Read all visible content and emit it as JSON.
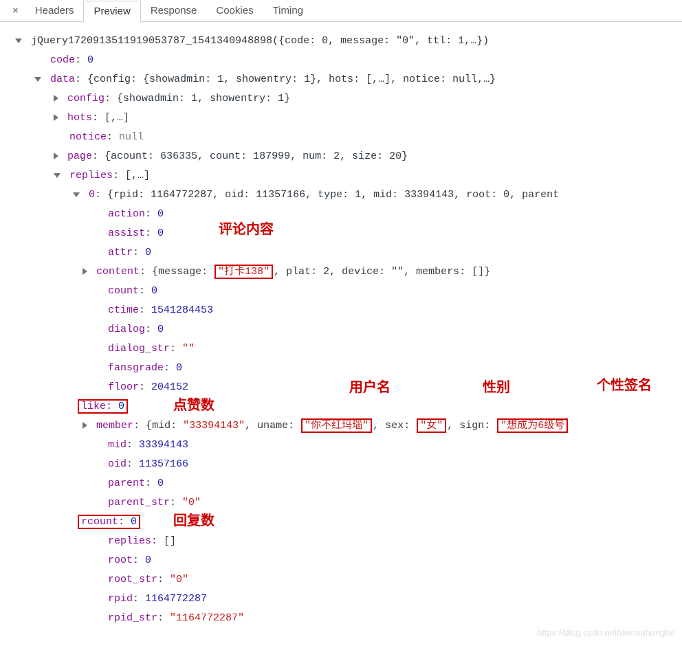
{
  "tabs": {
    "close": "×",
    "headers": "Headers",
    "preview": "Preview",
    "response": "Response",
    "cookies": "Cookies",
    "timing": "Timing"
  },
  "callback": "jQuery17209135119190537​87_1541340948898",
  "root_summary": "{code: 0, message: \"0\", ttl: 1,…}",
  "code": {
    "key": "code",
    "val": "0"
  },
  "data": {
    "key": "data",
    "summary": "{config: {showadmin: 1, showentry: 1}, hots: [,…], notice: null,…}",
    "config": {
      "key": "config",
      "summary": "{showadmin: 1, showentry: 1}"
    },
    "hots": {
      "key": "hots",
      "summary": "[,…]"
    },
    "notice": {
      "key": "notice",
      "val": "null"
    },
    "page": {
      "key": "page",
      "summary": "{acount: 636335, count: 187999, num: 2, size: 20}"
    },
    "replies": {
      "key": "replies",
      "summary": "[,…]",
      "item0": {
        "key": "0",
        "summary": "{rpid: 1164772287, oid: 11357166, type: 1, mid: 33394143, root: 0, parent",
        "action": {
          "key": "action",
          "val": "0"
        },
        "assist": {
          "key": "assist",
          "val": "0"
        },
        "attr": {
          "key": "attr",
          "val": "0"
        },
        "content": {
          "key": "content",
          "message_label": "message",
          "message_val": "\"打卡138\"",
          "rest": ", plat: 2, device: \"\", members: []}"
        },
        "count": {
          "key": "count",
          "val": "0"
        },
        "ctime": {
          "key": "ctime",
          "val": "1541284453"
        },
        "dialog": {
          "key": "dialog",
          "val": "0"
        },
        "dialog_str": {
          "key": "dialog_str",
          "val": "\"\""
        },
        "fansgrade": {
          "key": "fansgrade",
          "val": "0"
        },
        "floor": {
          "key": "floor",
          "val": "204152"
        },
        "like": {
          "key": "like",
          "val": "0"
        },
        "member": {
          "key": "member",
          "mid_label": "mid",
          "mid_val": "\"33394143\"",
          "uname_label": "uname",
          "uname_val": "\"你不红玛瑙\"",
          "sex_label": "sex",
          "sex_val": "\"女\"",
          "sign_label": "sign",
          "sign_val": "\"想成为6级号"
        },
        "mid": {
          "key": "mid",
          "val": "33394143"
        },
        "oid": {
          "key": "oid",
          "val": "11357166"
        },
        "parent": {
          "key": "parent",
          "val": "0"
        },
        "parent_str": {
          "key": "parent_str",
          "val": "\"0\""
        },
        "rcount": {
          "key": "rcount",
          "val": "0"
        },
        "repliesArr": {
          "key": "replies",
          "val": "[]"
        },
        "root": {
          "key": "root",
          "val": "0"
        },
        "root_str": {
          "key": "root_str",
          "val": "\"0\""
        },
        "rpid": {
          "key": "rpid",
          "val": "1164772287"
        },
        "rpid_str": {
          "key": "rpid_str",
          "val": "\"1164772287\""
        }
      }
    }
  },
  "annotations": {
    "comment_content": "评论内容",
    "like_count": "点赞数",
    "username": "用户名",
    "gender": "性别",
    "signature": "个性签名",
    "reply_count": "回复数"
  },
  "watermark": "https://blog.csdn.net/wenxuhonghe"
}
